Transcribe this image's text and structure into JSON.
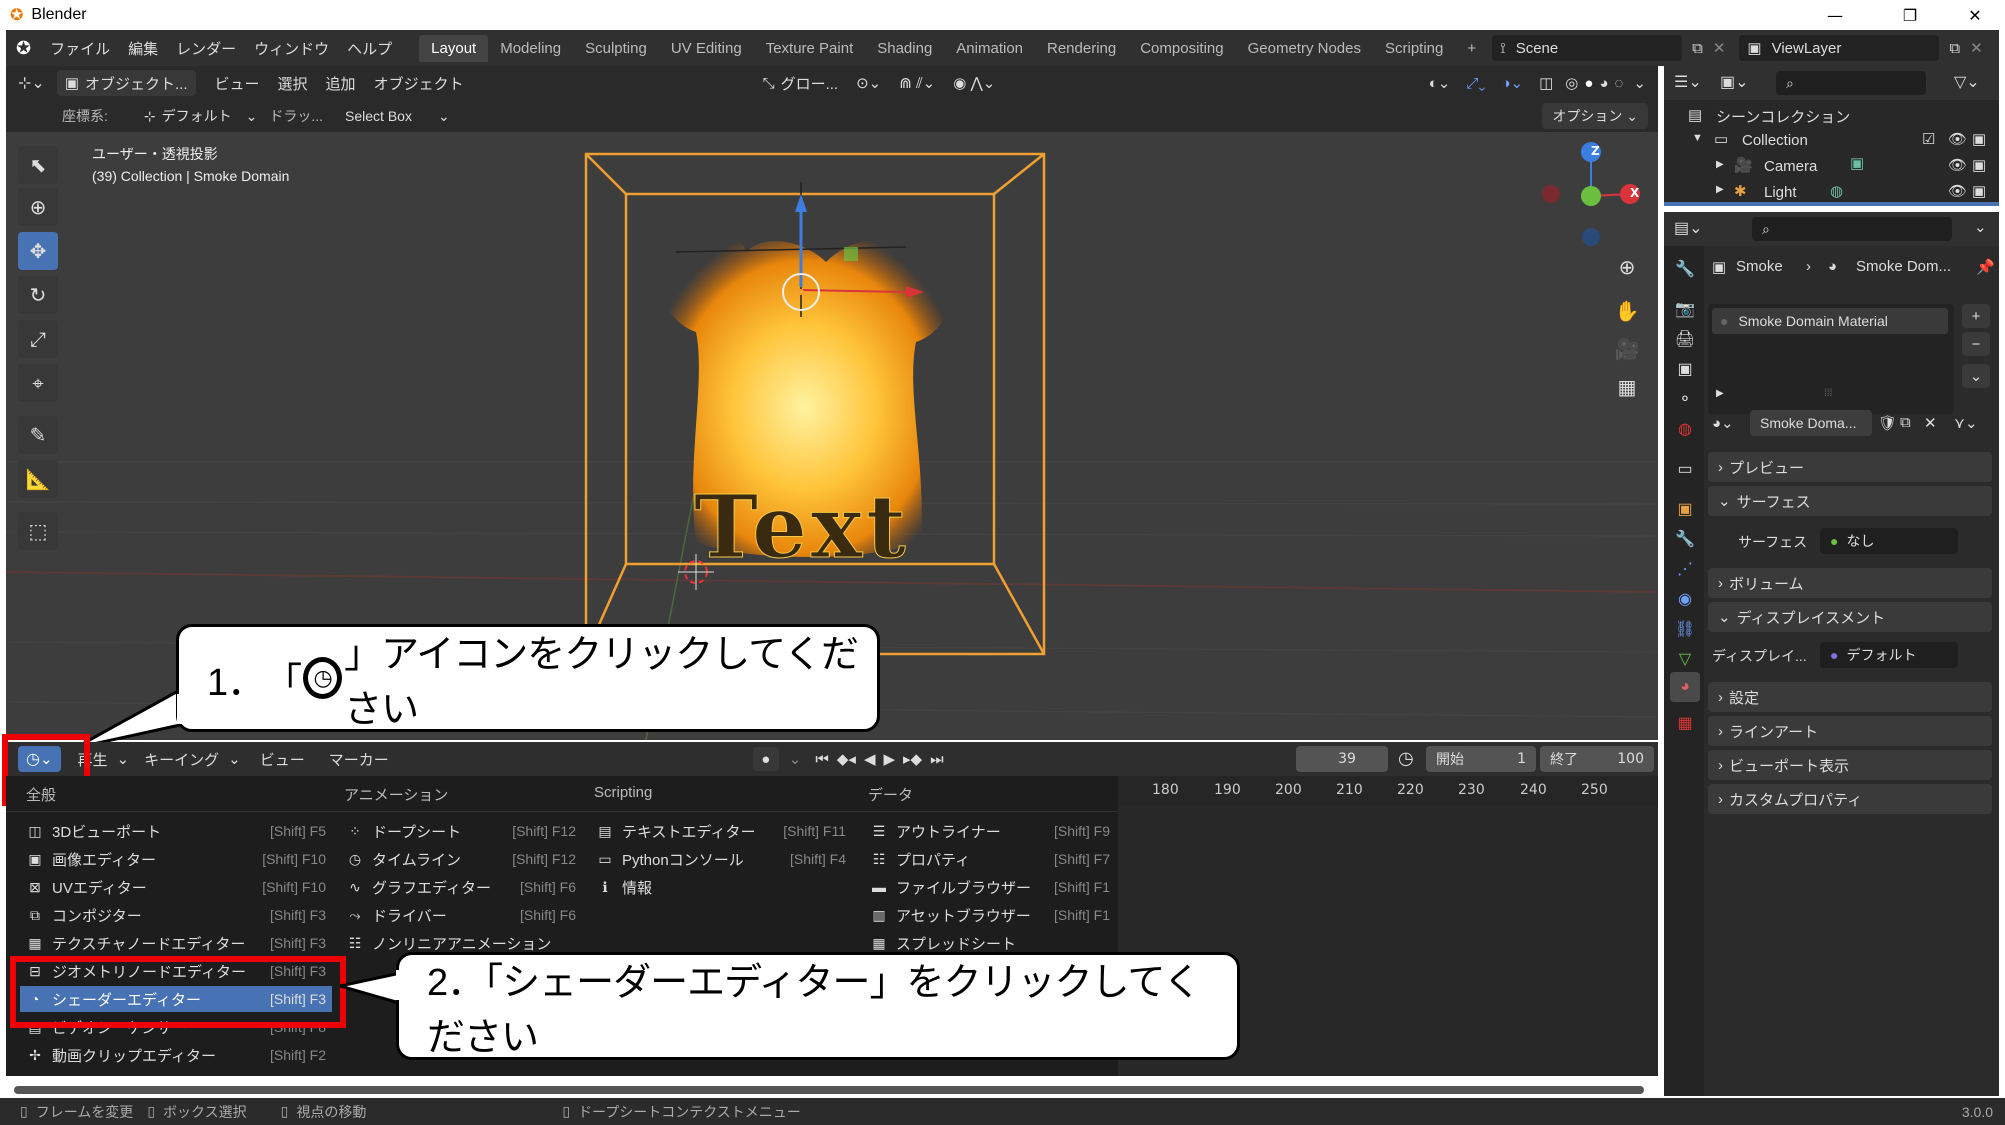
{
  "window": {
    "title": "Blender",
    "minimize": "—",
    "restore": "❐",
    "close": "✕"
  },
  "menu": [
    "ファイル",
    "編集",
    "レンダー",
    "ウィンドウ",
    "ヘルプ"
  ],
  "workspaces": [
    "Layout",
    "Modeling",
    "Sculpting",
    "UV Editing",
    "Texture Paint",
    "Shading",
    "Animation",
    "Rendering",
    "Compositing",
    "Geometry Nodes",
    "Scripting"
  ],
  "workspace_add": "+",
  "scene": "Scene",
  "view_layer": "ViewLayer",
  "viewport_header": {
    "mode": "オブジェクト...",
    "menus": [
      "ビュー",
      "選択",
      "追加",
      "オブジェクト"
    ],
    "transform": "グロー...",
    "coords_label": "座標系:",
    "coords_value": "デフォルト",
    "drag_label": "ドラッ...",
    "drag_value": "Select Box",
    "options": "オプション"
  },
  "viewport": {
    "view_name": "ユーザー・透視投影",
    "collection_info": "(39) Collection | Smoke Domain",
    "text_object": "Text",
    "gizmo_labels": {
      "z": "Z",
      "x": "X"
    }
  },
  "callout1": {
    "number": "1．",
    "text_before": "「",
    "text_after": "」アイコンをクリックしてください"
  },
  "callout2": {
    "text": "2．「シェーダーエディター」をクリックしてください"
  },
  "timeline": {
    "playback": "再生",
    "keying": "キーイング",
    "view": "ビュー",
    "marker": "マーカー",
    "current_frame": "39",
    "start_label": "開始",
    "start_value": "1",
    "end_label": "終了",
    "end_value": "100",
    "ticks": [
      "180",
      "190",
      "200",
      "210",
      "220",
      "230",
      "240",
      "250"
    ]
  },
  "editor_menu": {
    "columns": [
      "全般",
      "アニメーション",
      "Scripting",
      "データ"
    ],
    "general": [
      {
        "label": "3Dビューポート",
        "shortcut": "[Shift] F5",
        "icon": "◫"
      },
      {
        "label": "画像エディター",
        "shortcut": "[Shift] F10",
        "icon": "▣"
      },
      {
        "label": "UVエディター",
        "shortcut": "[Shift] F10",
        "icon": "⊠"
      },
      {
        "label": "コンポジター",
        "shortcut": "[Shift] F3",
        "icon": "⧉"
      },
      {
        "label": "テクスチャノードエディター",
        "shortcut": "[Shift] F3",
        "icon": "▦"
      },
      {
        "label": "ジオメトリノードエディター",
        "shortcut": "[Shift] F3",
        "icon": "⊟"
      },
      {
        "label": "シェーダーエディター",
        "shortcut": "[Shift] F3",
        "icon": "◔"
      },
      {
        "label": "ビデオシーケンサー",
        "shortcut": "[Shift] F8",
        "icon": "▤"
      },
      {
        "label": "動画クリップエディター",
        "shortcut": "[Shift] F2",
        "icon": "✢"
      }
    ],
    "animation": [
      {
        "label": "ドープシート",
        "shortcut": "[Shift] F12",
        "icon": "⁘"
      },
      {
        "label": "タイムライン",
        "shortcut": "[Shift] F12",
        "icon": "◷"
      },
      {
        "label": "グラフエディター",
        "shortcut": "[Shift] F6",
        "icon": "∿"
      },
      {
        "label": "ドライバー",
        "shortcut": "[Shift] F6",
        "icon": "⤳"
      },
      {
        "label": "ノンリニアアニメーション",
        "shortcut": "",
        "icon": "☷"
      }
    ],
    "scripting": [
      {
        "label": "テキストエディター",
        "shortcut": "[Shift] F11",
        "icon": "▤"
      },
      {
        "label": "Pythonコンソール",
        "shortcut": "[Shift] F4",
        "icon": "▭"
      },
      {
        "label": "情報",
        "shortcut": "",
        "icon": "ℹ"
      }
    ],
    "data": [
      {
        "label": "アウトライナー",
        "shortcut": "[Shift] F9",
        "icon": "☰"
      },
      {
        "label": "プロパティ",
        "shortcut": "[Shift] F7",
        "icon": "☷"
      },
      {
        "label": "ファイルブラウザー",
        "shortcut": "[Shift] F1",
        "icon": "▬"
      },
      {
        "label": "アセットブラウザー",
        "shortcut": "[Shift] F1",
        "icon": "▥"
      },
      {
        "label": "スプレッドシート",
        "shortcut": "",
        "icon": "▦"
      }
    ]
  },
  "outliner": {
    "root": "シーンコレクション",
    "items": [
      {
        "label": "Collection",
        "level": 1
      },
      {
        "label": "Camera",
        "level": 2
      },
      {
        "label": "Light",
        "level": 2
      }
    ]
  },
  "properties": {
    "breadcrumb_object": "Smoke",
    "breadcrumb_material": "Smoke Dom...",
    "material_slot": "Smoke Domain Material",
    "material_name": "Smoke Doma...",
    "panels": [
      "プレビュー",
      "サーフェス",
      "ボリューム",
      "ディスプレイスメント",
      "設定",
      "ラインアート",
      "ビューポート表示",
      "カスタムプロパティ"
    ],
    "surface_label": "サーフェス",
    "surface_value": "なし",
    "displacement_label": "ディスプレイ...",
    "displacement_value": "デフォルト"
  },
  "statusbar": {
    "items": [
      "フレームを変更",
      "ボックス選択",
      "視点の移動",
      "ドープシートコンテクストメニュー"
    ],
    "version": "3.0.0"
  },
  "colors": {
    "accent": "#4772b3",
    "highlight_red": "#ee0000",
    "selection_orange": "#f0a030"
  }
}
